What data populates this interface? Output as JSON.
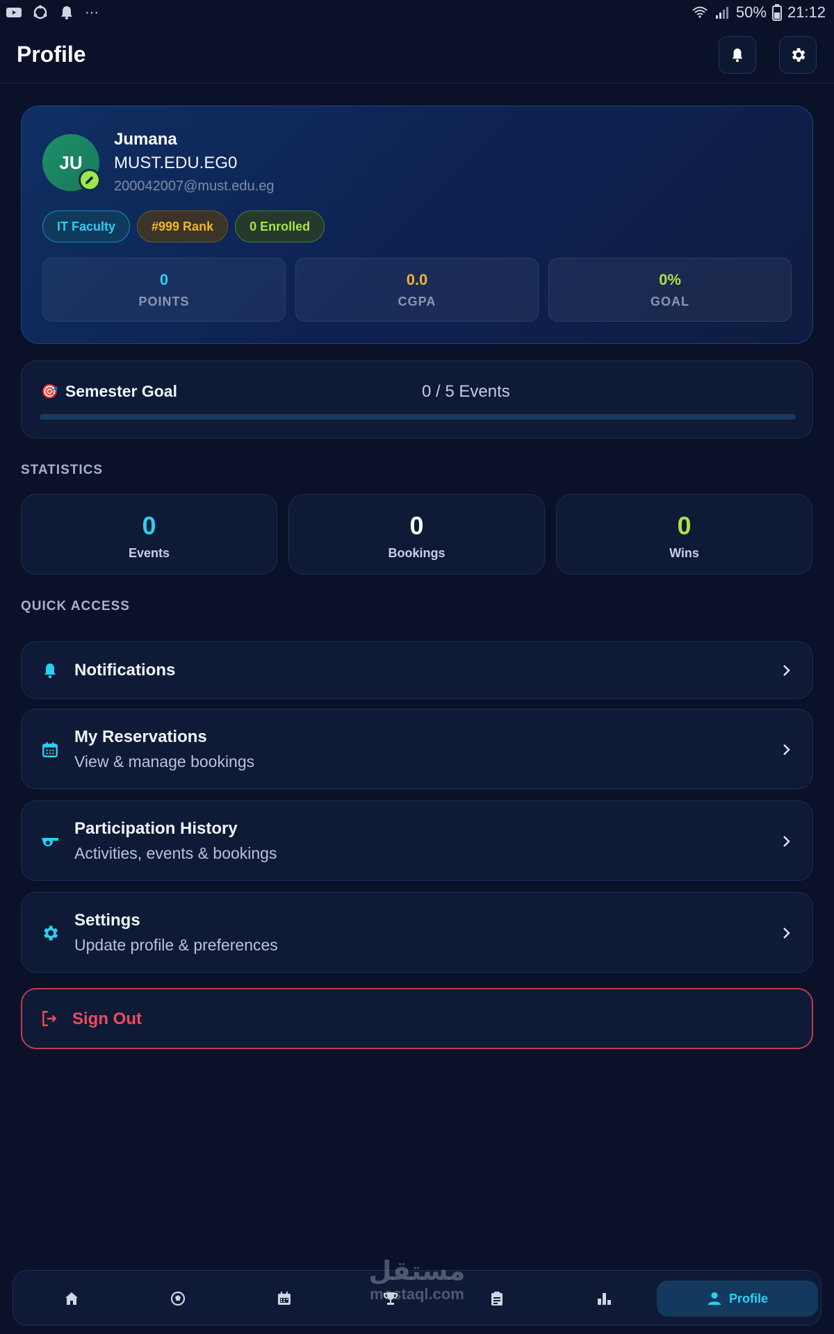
{
  "status_bar": {
    "battery": "50%",
    "time": "21:12",
    "overflow": "···"
  },
  "header": {
    "title": "Profile"
  },
  "profile": {
    "initials": "JU",
    "name": "Jumana",
    "domain": "MUST.EDU.EG0",
    "email": "200042007@must.edu.eg",
    "chips": {
      "faculty": "IT Faculty",
      "rank": "#999 Rank",
      "enrolled": "0 Enrolled"
    },
    "stats": [
      {
        "value": "0",
        "label": "POINTS",
        "color": "#2ad0f0"
      },
      {
        "value": "0.0",
        "label": "CGPA",
        "color": "#f3b52a"
      },
      {
        "value": "0%",
        "label": "GOAL",
        "color": "#a8e24a"
      }
    ]
  },
  "semester_goal": {
    "emoji": "🎯",
    "title": "Semester Goal",
    "count": "0 / 5 Events",
    "progress": 0
  },
  "statistics": {
    "label": "STATISTICS",
    "cards": [
      {
        "value": "0",
        "label": "Events",
        "color": "#2ad0f0"
      },
      {
        "value": "0",
        "label": "Bookings",
        "color": "#ffffff"
      },
      {
        "value": "0",
        "label": "Wins",
        "color": "#a8e24a"
      }
    ]
  },
  "quick_access": {
    "label": "QUICK ACCESS",
    "items": [
      {
        "title": "Notifications",
        "subtitle": "",
        "icon": "bell-icon"
      },
      {
        "title": "My Reservations",
        "subtitle": "View & manage bookings",
        "icon": "calendar-icon"
      },
      {
        "title": "Participation History",
        "subtitle": "Activities, events & bookings",
        "icon": "whistle-icon"
      },
      {
        "title": "Settings",
        "subtitle": "Update profile & preferences",
        "icon": "gear-icon"
      }
    ]
  },
  "sign_out": {
    "label": "Sign Out",
    "color": "#f04a5e"
  },
  "bottom_nav": {
    "items": [
      "home-icon",
      "football-icon",
      "calendar-icon",
      "trophy-icon",
      "clipboard-icon",
      "bar-chart-icon"
    ],
    "active_label": "Profile"
  },
  "watermark": {
    "arabic": "مستقل",
    "latin": "mostaql.com"
  },
  "colors": {
    "accent": "#2ad0f0",
    "background": "#0a1128",
    "danger": "#f04a5e"
  }
}
